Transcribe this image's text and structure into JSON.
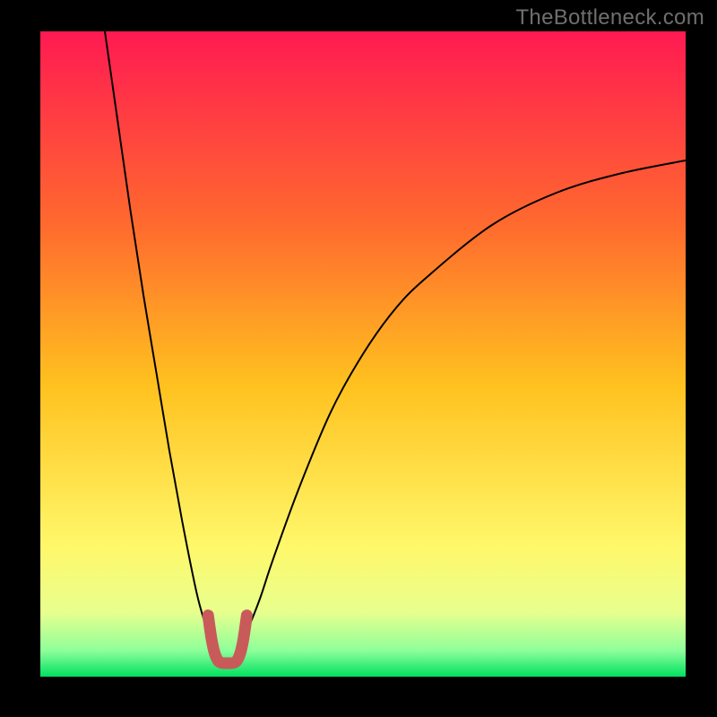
{
  "watermark": "TheBottleneck.com",
  "colors": {
    "frame": "#000000",
    "gradient_stops": [
      {
        "offset": 0.0,
        "color": "#ff1a52"
      },
      {
        "offset": 0.3,
        "color": "#ff6a2e"
      },
      {
        "offset": 0.55,
        "color": "#ffc21f"
      },
      {
        "offset": 0.8,
        "color": "#fff86b"
      },
      {
        "offset": 0.9,
        "color": "#e8ff8e"
      },
      {
        "offset": 0.96,
        "color": "#8dff9a"
      },
      {
        "offset": 1.0,
        "color": "#00e060"
      }
    ],
    "curve": "#000000",
    "marker": "#c95a5a"
  },
  "chart_data": {
    "type": "line",
    "title": "",
    "xlabel": "",
    "ylabel": "",
    "xlim": [
      0,
      100
    ],
    "ylim": [
      0,
      100
    ],
    "grid": false,
    "legend": false,
    "notes": "Axes are unlabeled in the original image. x and y are normalized 0–100 estimates from pixel positions: x left→right, y bottom→top.",
    "series": [
      {
        "name": "left-branch",
        "x": [
          10,
          12,
          14,
          16,
          18,
          20,
          22,
          24,
          25,
          26,
          27
        ],
        "y": [
          100,
          86,
          72,
          59,
          47,
          35,
          24,
          14,
          10,
          7,
          5
        ]
      },
      {
        "name": "right-branch",
        "x": [
          31,
          32,
          34,
          36,
          40,
          45,
          50,
          55,
          60,
          70,
          80,
          90,
          100
        ],
        "y": [
          5,
          7,
          12,
          18,
          29,
          41,
          50,
          57,
          62,
          70,
          75,
          78,
          80
        ]
      },
      {
        "name": "valley-marker",
        "x": [
          26,
          26.5,
          27,
          27.6,
          28.3,
          29,
          29.7,
          30.4,
          31,
          31.5,
          32
        ],
        "y": [
          9.5,
          6,
          3.7,
          2.4,
          2.1,
          2.1,
          2.1,
          2.4,
          3.7,
          6,
          9.5
        ]
      }
    ]
  }
}
